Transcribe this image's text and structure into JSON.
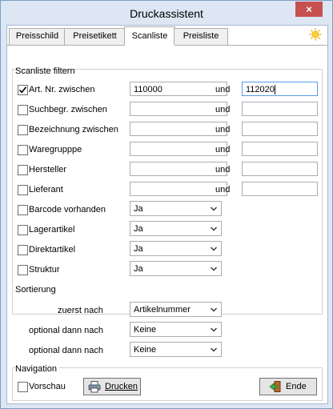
{
  "window": {
    "title": "Druckassistent",
    "close_label": "×"
  },
  "tabs": [
    "Preisschild",
    "Preisetikett",
    "Scanliste",
    "Preisliste"
  ],
  "active_tab": "Scanliste",
  "filter": {
    "group_title": "Scanliste filtern",
    "range_rows": [
      {
        "label": "Art. Nr. zwischen",
        "checked": true,
        "from": "110000",
        "and": "und",
        "to": "112020"
      },
      {
        "label": "Suchbegr. zwischen",
        "checked": false,
        "from": "",
        "and": "und",
        "to": ""
      },
      {
        "label": "Bezeichnung zwischen",
        "checked": false,
        "from": "",
        "and": "und",
        "to": ""
      },
      {
        "label": "Waregrupppe",
        "checked": false,
        "from": "",
        "and": "und",
        "to": ""
      },
      {
        "label": "Hersteller",
        "checked": false,
        "from": "",
        "and": "und",
        "to": ""
      },
      {
        "label": "Lieferant",
        "checked": false,
        "from": "",
        "and": "und",
        "to": ""
      }
    ],
    "select_rows": [
      {
        "label": "Barcode vorhanden",
        "checked": false,
        "value": "Ja"
      },
      {
        "label": "Lagerartikel",
        "checked": false,
        "value": "Ja"
      },
      {
        "label": "Direktartikel",
        "checked": false,
        "value": "Ja"
      },
      {
        "label": "Struktur",
        "checked": false,
        "value": "Ja"
      }
    ]
  },
  "sort": {
    "group_title": "Sortierung",
    "rows": [
      {
        "label": "zuerst nach",
        "value": "Artikelnummer"
      },
      {
        "label": "optional dann nach",
        "value": "Keine"
      },
      {
        "label": "optional dann nach",
        "value": "Keine"
      }
    ]
  },
  "navigation": {
    "group_title": "Navigation",
    "preview_label": "Vorschau",
    "preview_checked": false,
    "print_label": "Drucken",
    "end_label": "Ende"
  }
}
